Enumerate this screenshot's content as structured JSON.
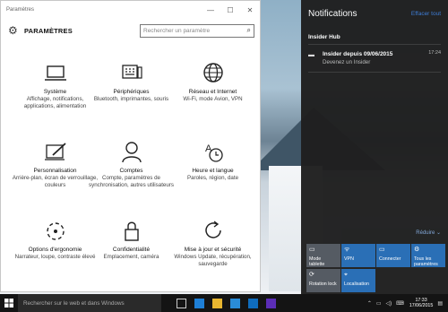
{
  "window": {
    "title": "Paramètres"
  },
  "header": {
    "title": "PARAMÈTRES",
    "search_placeholder": "Rechercher un paramètre"
  },
  "categories": [
    {
      "name": "Système",
      "desc": "Affichage, notifications, applications, alimentation",
      "icon": "laptop-icon"
    },
    {
      "name": "Périphériques",
      "desc": "Bluetooth, imprimantes, souris",
      "icon": "keyboard-icon"
    },
    {
      "name": "Réseau et Internet",
      "desc": "Wi-Fi, mode Avion, VPN",
      "icon": "globe-icon"
    },
    {
      "name": "Personnalisation",
      "desc": "Arrière-plan, écran de verrouillage, couleurs",
      "icon": "paint-icon"
    },
    {
      "name": "Comptes",
      "desc": "Compte, paramètres de synchronisation, autres utilisateurs",
      "icon": "person-icon"
    },
    {
      "name": "Heure et langue",
      "desc": "Paroles, région, date",
      "icon": "time-language-icon"
    },
    {
      "name": "Options d'ergonomie",
      "desc": "Narrateur, loupe, contraste élevé",
      "icon": "ease-of-access-icon"
    },
    {
      "name": "Confidentialité",
      "desc": "Emplacement, caméra",
      "icon": "lock-icon"
    },
    {
      "name": "Mise à jour et sécurité",
      "desc": "Windows Update, récupération, sauvegarde",
      "icon": "update-icon"
    }
  ],
  "action_center": {
    "title": "Notifications",
    "clear_all": "Effacer tout",
    "group": "Insider Hub",
    "notification": {
      "title": "Insider depuis 09/06/2015",
      "subtitle": "Devenez un Insider",
      "time": "17:24"
    },
    "collapse": "Réduire",
    "tiles": [
      {
        "label": "Mode tablette",
        "icon": "tablet-mode-icon",
        "active": false
      },
      {
        "label": "VPN",
        "icon": "vpn-icon",
        "active": true
      },
      {
        "label": "Connecter",
        "icon": "connect-icon",
        "active": true
      },
      {
        "label": "Tous les paramètres",
        "icon": "settings-icon",
        "active": true
      },
      {
        "label": "Rotation lock",
        "icon": "rotation-lock-icon",
        "active": false
      },
      {
        "label": "Localisation",
        "icon": "location-icon",
        "active": true
      }
    ]
  },
  "taskbar": {
    "search_placeholder": "Rechercher sur le web et dans Windows",
    "time": "17:33",
    "date": "17/06/2015",
    "accent": "#2a6fb6"
  }
}
